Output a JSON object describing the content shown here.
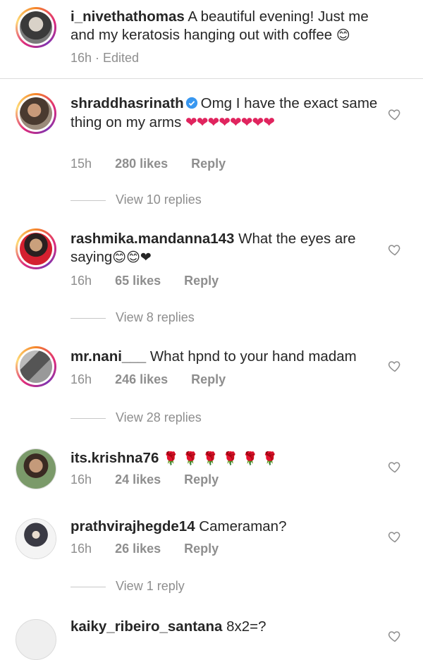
{
  "caption": {
    "username": "i_nivethathomas",
    "text": "A beautiful evening! Just me and my keratosis hanging out with coffee",
    "emoji": "😊",
    "meta": "16h · Edited"
  },
  "comments": [
    {
      "username": "shraddhasrinath",
      "verified": true,
      "text": "Omg I have the exact same thing on my arms",
      "emoji": "❤❤❤❤❤❤❤❤",
      "time": "15h",
      "likes": "280 likes",
      "reply": "Reply",
      "view_replies": "View 10 replies"
    },
    {
      "username": "rashmika.mandanna143",
      "text": "What the eyes are saying",
      "emoji": "😊😊❤",
      "time": "16h",
      "likes": "65 likes",
      "reply": "Reply",
      "view_replies": "View 8 replies"
    },
    {
      "username": "mr.nani___",
      "text": "What hpnd to your hand madam",
      "time": "16h",
      "likes": "246 likes",
      "reply": "Reply",
      "view_replies": "View 28 replies"
    },
    {
      "username": "its.krishna76",
      "emoji": "🌹 🌹 🌹 🌹 🌹 🌹",
      "time": "16h",
      "likes": "24 likes",
      "reply": "Reply"
    },
    {
      "username": "prathvirajhegde14",
      "text": "Cameraman?",
      "time": "16h",
      "likes": "26 likes",
      "reply": "Reply",
      "view_replies": "View 1 reply"
    },
    {
      "username": "kaiky_ribeiro_santana",
      "text": "8x2=?"
    }
  ],
  "colors": {
    "accent_blue": "#3897f0",
    "muted": "#8e8e8e",
    "heart": "#e0245e"
  }
}
